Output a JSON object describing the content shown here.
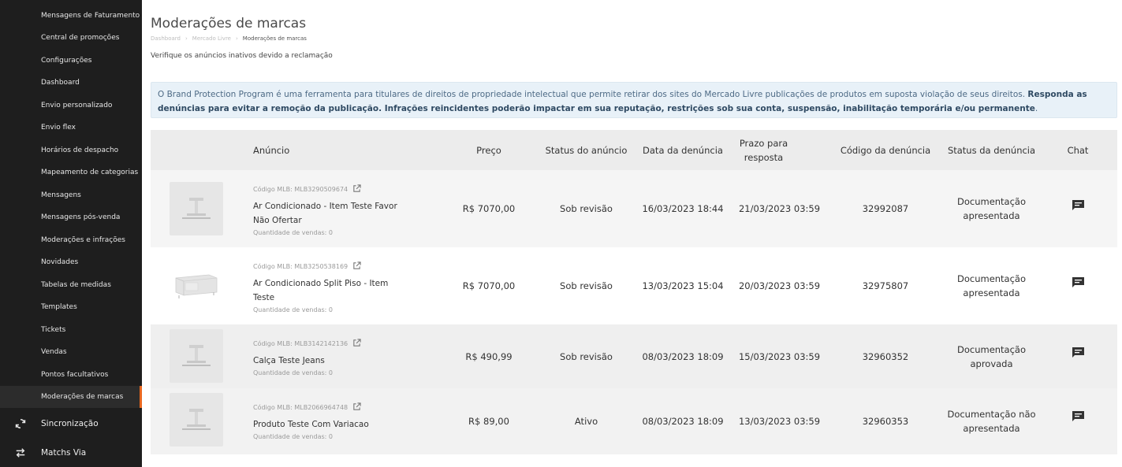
{
  "sidebar": {
    "items": [
      {
        "label": "Mensagens de Faturamento"
      },
      {
        "label": "Central de promoções"
      },
      {
        "label": "Configurações"
      },
      {
        "label": "Dashboard"
      },
      {
        "label": "Envio personalizado"
      },
      {
        "label": "Envio flex"
      },
      {
        "label": "Horários de despacho"
      },
      {
        "label": "Mapeamento de categorias"
      },
      {
        "label": "Mensagens"
      },
      {
        "label": "Mensagens pós-venda"
      },
      {
        "label": "Moderações e infrações"
      },
      {
        "label": "Novidades"
      },
      {
        "label": "Tabelas de medidas"
      },
      {
        "label": "Templates"
      },
      {
        "label": "Tickets"
      },
      {
        "label": "Vendas"
      },
      {
        "label": "Pontos facultativos"
      },
      {
        "label": "Moderações de marcas"
      }
    ],
    "sync": {
      "label": "Sincronização",
      "icon": "sync-icon"
    },
    "matchs": {
      "label": "Matchs Via",
      "icon": "swap-icon"
    },
    "active_color": "#e8671f"
  },
  "page": {
    "title": "Moderações de marcas",
    "breadcrumb": [
      "Dashboard",
      "Mercado Livre",
      "Moderações de marcas"
    ],
    "subtitle": "Verifique os anúncios inativos devido a reclamação"
  },
  "info": {
    "normal": "O Brand Protection Program é uma ferramenta para titulares de direitos de propriedade intelectual que permite retirar dos sites do Mercado Livre publicações de produtos em suposta violação de seus direitos. ",
    "bold": "Responda as denúncias para evitar a remoção da publicação. Infrações reincidentes poderão impactar em sua reputação, restrições sob sua conta, suspensão, inabilitação temporária e/ou permanente",
    "end": "."
  },
  "table": {
    "headers": {
      "anuncio": "Anúncio",
      "preco": "Preço",
      "status_anuncio": "Status do anúncio",
      "data_denuncia": "Data da denúncia",
      "prazo": "Prazo para resposta",
      "codigo": "Código da denúncia",
      "status_denuncia": "Status da denúncia",
      "chat": "Chat"
    },
    "rows": [
      {
        "code": "Código MLB: MLB3290509674",
        "name": "Ar Condicionado - Item Teste Favor Não Ofertar",
        "qty": "Quantidade de vendas: 0",
        "price": "R$ 7070,00",
        "status": "Sob revisão",
        "date": "16/03/2023 18:44",
        "deadline": "21/03/2023 03:59",
        "complaint_code": "32992087",
        "complaint_status": "Documentação apresentada"
      },
      {
        "code": "Código MLB: MLB3250538169",
        "name": "Ar Condicionado Split Piso - Item Teste",
        "qty": "Quantidade de vendas: 0",
        "price": "R$ 7070,00",
        "status": "Sob revisão",
        "date": "13/03/2023 15:04",
        "deadline": "20/03/2023 03:59",
        "complaint_code": "32975807",
        "complaint_status": "Documentação apresentada"
      },
      {
        "code": "Código MLB: MLB3142142136",
        "name": "Calça Teste Jeans",
        "qty": "Quantidade de vendas: 0",
        "price": "R$ 490,99",
        "status": "Sob revisão",
        "date": "08/03/2023 18:09",
        "deadline": "15/03/2023 03:59",
        "complaint_code": "32960352",
        "complaint_status": "Documentação aprovada"
      },
      {
        "code": "Código MLB: MLB2066964748",
        "name": "Produto Teste Com Variacao",
        "qty": "Quantidade de vendas: 0",
        "price": "R$ 89,00",
        "status": "Ativo",
        "date": "08/03/2023 18:09",
        "deadline": "13/03/2023 03:59",
        "complaint_code": "32960353",
        "complaint_status": "Documentação não apresentada"
      }
    ]
  }
}
